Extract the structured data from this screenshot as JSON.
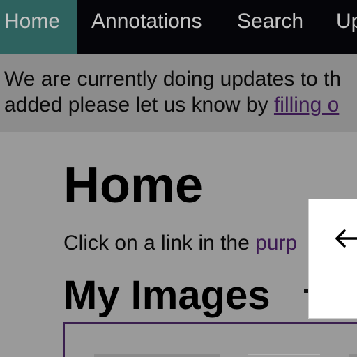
{
  "nav": {
    "items": [
      {
        "label": "Home",
        "active": true
      },
      {
        "label": "Annotations",
        "active": false
      },
      {
        "label": "Search",
        "active": false
      },
      {
        "label": "Up",
        "active": false
      }
    ]
  },
  "notice": {
    "line1": "We are currently doing updates to th",
    "line2_text": "added please let us know by ",
    "line2_link": "filling o"
  },
  "main": {
    "title": "Home",
    "intro_text": "Click on a link in the ",
    "intro_link": "purp",
    "section_title": "My Images"
  },
  "panel": {
    "back_icon": "arrow-left-icon"
  },
  "colors": {
    "nav_background": "#050509",
    "nav_active": "#2e625f",
    "page_overlay": "#9a9a9a",
    "link": "#3c1a52"
  }
}
